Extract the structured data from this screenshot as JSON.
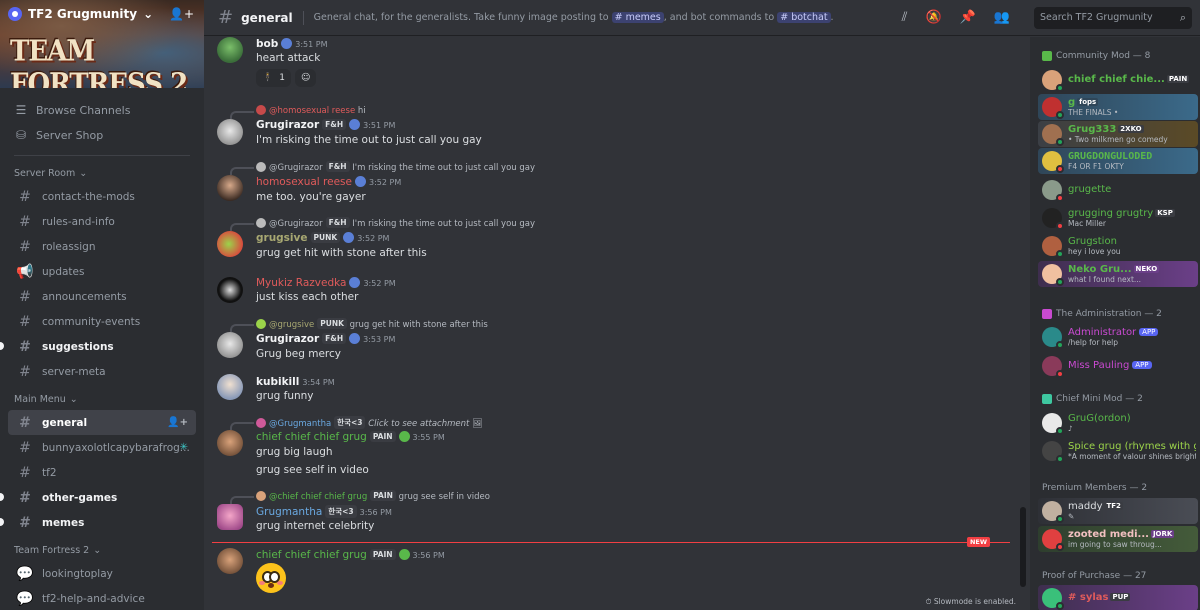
{
  "server": {
    "name": "TF2 Grugmunity",
    "banner_text": "TEAM FORTRESS 2"
  },
  "sidebar": {
    "top_items": [
      {
        "label": "Browse Channels"
      },
      {
        "label": "Server Shop"
      }
    ],
    "categories": [
      {
        "name": "Server Room",
        "channels": [
          {
            "label": "contact-the-mods"
          },
          {
            "label": "rules-and-info"
          },
          {
            "label": "roleassign"
          },
          {
            "label": "updates"
          },
          {
            "label": "announcements"
          },
          {
            "label": "community-events"
          },
          {
            "label": "suggestions"
          },
          {
            "label": "server-meta"
          }
        ]
      },
      {
        "name": "Main Menu",
        "channels": [
          {
            "label": "general"
          },
          {
            "label": "bunnyaxolotlcapybarafrog..."
          },
          {
            "label": "tf2"
          },
          {
            "label": "other-games"
          },
          {
            "label": "memes"
          }
        ]
      },
      {
        "name": "Team Fortress 2",
        "channels": [
          {
            "label": "lookingtoplay"
          },
          {
            "label": "tf2-help-and-advice"
          }
        ]
      }
    ]
  },
  "topbar": {
    "channel": "general",
    "topic_pre": "General chat, for the generalists. Take funny image posting to",
    "topic_mid": ", and bot commands to",
    "topic_post": ".",
    "mention1": "memes",
    "mention2": "botchat",
    "search_placeholder": "Search TF2 Grugmunity"
  },
  "messages": [
    {
      "user": "bob",
      "time": "3:51 PM",
      "text": "heart attack",
      "reaction_count": "1"
    },
    {
      "reply_user": "@homosexual reese",
      "reply_text": "hi",
      "user": "Grugirazor",
      "tag": "F&H",
      "time": "3:51 PM",
      "text": "I'm risking the time out to just call you gay"
    },
    {
      "reply_user": "@Grugirazor",
      "reply_tag": "F&H",
      "reply_text": "I'm risking the time out to just call you gay",
      "user": "homosexual reese",
      "time": "3:52 PM",
      "text": "me too. you're gayer"
    },
    {
      "reply_user": "@Grugirazor",
      "reply_tag": "F&H",
      "reply_text": "I'm risking the time out to just call you gay",
      "user": "grugsive",
      "tag": "PUNK",
      "time": "3:52 PM",
      "text": "grug get hit with stone after this"
    },
    {
      "user": "Myukiz Razvedka",
      "time": "3:52 PM",
      "text": "just kiss each other"
    },
    {
      "reply_user": "@grugsive",
      "reply_tag": "PUNK",
      "reply_text": "grug get hit with stone after this",
      "user": "Grugirazor",
      "tag": "F&H",
      "time": "3:53 PM",
      "text": "Grug beg mercy"
    },
    {
      "user": "kubikill",
      "time": "3:54 PM",
      "text": "grug funny"
    },
    {
      "reply_user": "@Grugmantha",
      "reply_tag": "한국<3",
      "reply_text": "Click to see attachment",
      "user": "chief chief chief grug",
      "tag": "PAIN",
      "time": "3:55 PM",
      "text": "grug big laugh",
      "text2": "grug see self in video"
    },
    {
      "reply_user": "@chief chief chief grug",
      "reply_tag": "PAIN",
      "reply_text": "grug see self in video",
      "user": "Grugmantha",
      "tag": "한국<3",
      "time": "3:56 PM",
      "text": "grug internet celebrity"
    },
    {
      "user": "chief chief chief grug",
      "tag": "PAIN",
      "time": "3:56 PM"
    }
  ],
  "new_label": "NEW",
  "slowmode": "Slowmode is enabled.",
  "member_list": {
    "groups": [
      {
        "name": "Community Mod — 8"
      },
      {
        "name": "The Administration — 2"
      },
      {
        "name": "Chief Mini Mod — 2"
      },
      {
        "name": "Premium Members — 2"
      },
      {
        "name": "Proof of Purchase — 27"
      }
    ],
    "members": [
      {
        "name": "chief chief chie...",
        "tag": "PAIN"
      },
      {
        "name": "g",
        "tag": "fops",
        "sub": "THE FINALS •"
      },
      {
        "name": "Grug333",
        "tag": "2XKO",
        "sub": "• Two milkmen go comedy"
      },
      {
        "name": "GRUGDONGULODED",
        "sub": "F4 OR F1 OKTY"
      },
      {
        "name": "grugette"
      },
      {
        "name": "grugging grugtry",
        "tag": "KSP",
        "sub": "Mac Miller"
      },
      {
        "name": "Grugstion",
        "sub": "hey i love you"
      },
      {
        "name": "Neko Gru...",
        "tag": "NEKO",
        "sub": "what I found next..."
      },
      {
        "name": "Administrator",
        "tag": "APP",
        "sub": "/help for help"
      },
      {
        "name": "Miss Pauling",
        "tag": "APP"
      },
      {
        "name": "GruG(ordon)"
      },
      {
        "name": "Spice grug (rhymes with g...",
        "sub": "*A moment of valour shines bright..."
      },
      {
        "name": "maddy",
        "tag": "TF2"
      },
      {
        "name": "zooted medi...",
        "tag": "JORK",
        "sub": "im going to saw throug..."
      },
      {
        "name": "# sylas",
        "tag": "PUP"
      }
    ]
  },
  "colors": {
    "accent": "#5865f2",
    "mod_green": "#59b84a",
    "reese_red": "#e05b5b",
    "grugsive_olive": "#a8a872",
    "admin_magenta": "#c94ad1",
    "grugmantha_blue": "#6aa8e0"
  }
}
